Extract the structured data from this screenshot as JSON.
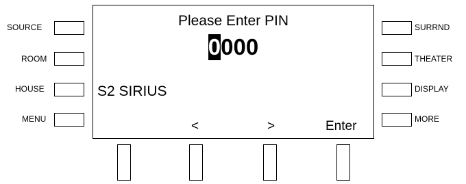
{
  "left_buttons": [
    {
      "label": "SOURCE"
    },
    {
      "label": "ROOM"
    },
    {
      "label": "HOUSE"
    },
    {
      "label": "MENU"
    }
  ],
  "right_buttons": [
    {
      "label": "SURRND"
    },
    {
      "label": "THEATER"
    },
    {
      "label": "DISPLAY"
    },
    {
      "label": "MORE"
    }
  ],
  "screen": {
    "title": "Please Enter PIN",
    "pin_digits": [
      "0",
      "0",
      "0",
      "0"
    ],
    "active_digit_index": 0,
    "source_line": "S2 SIRIUS",
    "soft_labels": [
      "<",
      ">",
      "Enter"
    ]
  },
  "colors": {
    "background": "#ffffff",
    "foreground": "#000000"
  }
}
